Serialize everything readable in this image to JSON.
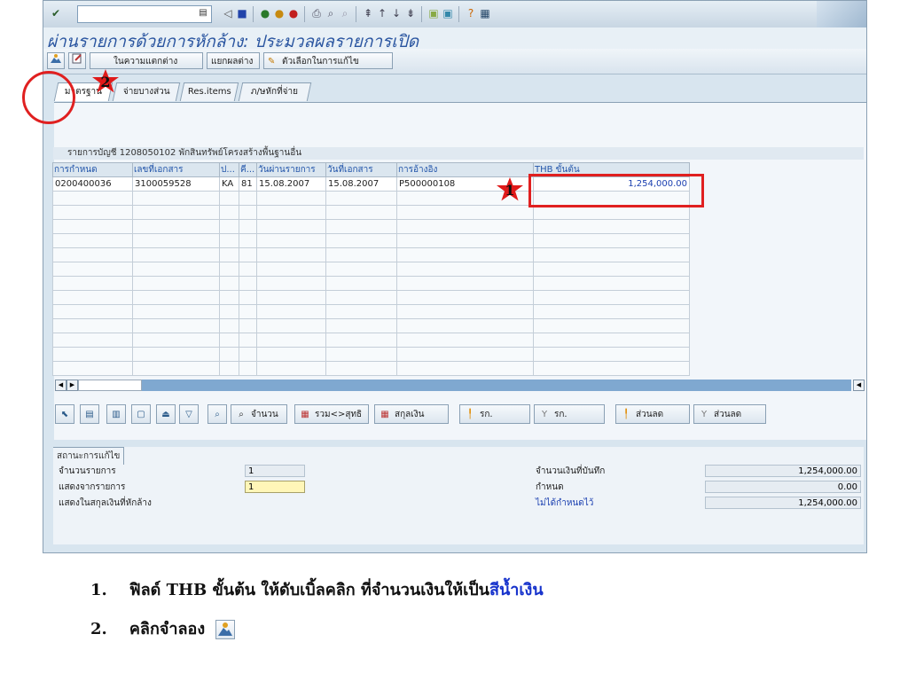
{
  "window": {
    "title": "ผ่านรายการด้วยการหักล้าง: ประมวลผลรายการเปิด"
  },
  "app_toolbar": {
    "btn_simulate_icon": "simulate-icon",
    "btn_differences": "ในความแตกต่าง",
    "btn_split": "แยกผลต่าง",
    "btn_options": "ตัวเลือกในการแก้ไข"
  },
  "tabs": [
    "มาตรฐาน",
    "จ่ายบางส่วน",
    "Res.items",
    "ภ/ษหักที่จ่าย"
  ],
  "grid": {
    "account_title": "รายการบัญชี 1208050102 พักสินทรัพย์โครงสร้างพื้นฐานอื่น",
    "columns": [
      "การกำหนด",
      "เลขที่เอกสาร",
      "ป...",
      "คี...",
      "วันผ่านรายการ",
      "วันที่เอกสาร",
      "การอ้างอิง",
      "THB ขั้นต้น"
    ],
    "rows": [
      [
        "0200400036",
        "3100059528",
        "KA",
        "81",
        "15.08.2007",
        "15.08.2007",
        "P500000108",
        "1,254,000.00"
      ]
    ],
    "empty_rows": 13
  },
  "grid_toolbar": {
    "amount": "จำนวน",
    "net_gross": "รวม<>สุทธิ",
    "currency": "สกุลเงิน",
    "items1": "รก.",
    "items2": "รก.",
    "discount1": "ส่วนลด",
    "discount2": "ส่วนลด"
  },
  "status": {
    "header": "สถานะการแก้ไข",
    "count_label": "จำนวนรายการ",
    "count_value": "1",
    "display_from_label": "แสดงจากรายการ",
    "display_from_value": "1",
    "currency_label": "แสดงในสกุลเงินที่หักล้าง",
    "entered_label": "จำนวนเงินที่บันทึก",
    "entered_value": "1,254,000.00",
    "assigned_label": "กำหนด",
    "assigned_value": "0.00",
    "not_assigned_label": "ไม่ได้กำหนดไว้",
    "not_assigned_value": "1,254,000.00"
  },
  "annotations": {
    "badge1": "1",
    "badge2": "2"
  },
  "instructions": [
    {
      "num": "1.",
      "text": "ฟิลด์ THB ขั้นต้น ให้ดับเบิ้ลคลิก ที่จำนวนเงินให้เป็น",
      "highlight": "สีน้ำเงิน"
    },
    {
      "num": "2.",
      "text": "คลิกจำลอง"
    }
  ],
  "colors": {
    "accent_blue": "#1733cc",
    "highlight_red": "#e02020",
    "title_blue": "#2a55a0"
  }
}
